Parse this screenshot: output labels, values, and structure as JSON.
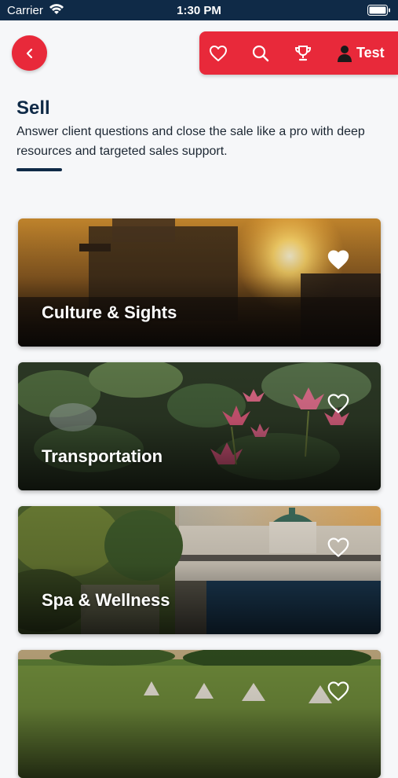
{
  "status_bar": {
    "carrier": "Carrier",
    "time": "1:30 PM",
    "wifi_icon": "wifi-icon",
    "battery_icon": "battery-icon"
  },
  "header": {
    "back_icon": "chevron-left-icon",
    "toolbar": {
      "favorites_icon": "heart-outline-icon",
      "search_icon": "search-icon",
      "trophy_icon": "trophy-icon",
      "user_icon": "user-icon",
      "user_label": "Test"
    }
  },
  "page": {
    "title": "Sell",
    "subtitle": "Answer client questions and close the sale like a pro with deep resources and targeted sales support."
  },
  "cards": [
    {
      "title": "Culture & Sights",
      "favorited": true
    },
    {
      "title": "Transportation",
      "favorited": false
    },
    {
      "title": "Spa & Wellness",
      "favorited": false
    },
    {
      "title": "",
      "favorited": false
    }
  ],
  "colors": {
    "accent": "#e8293a",
    "navy": "#0f2a47",
    "background": "#f6f7f9"
  }
}
